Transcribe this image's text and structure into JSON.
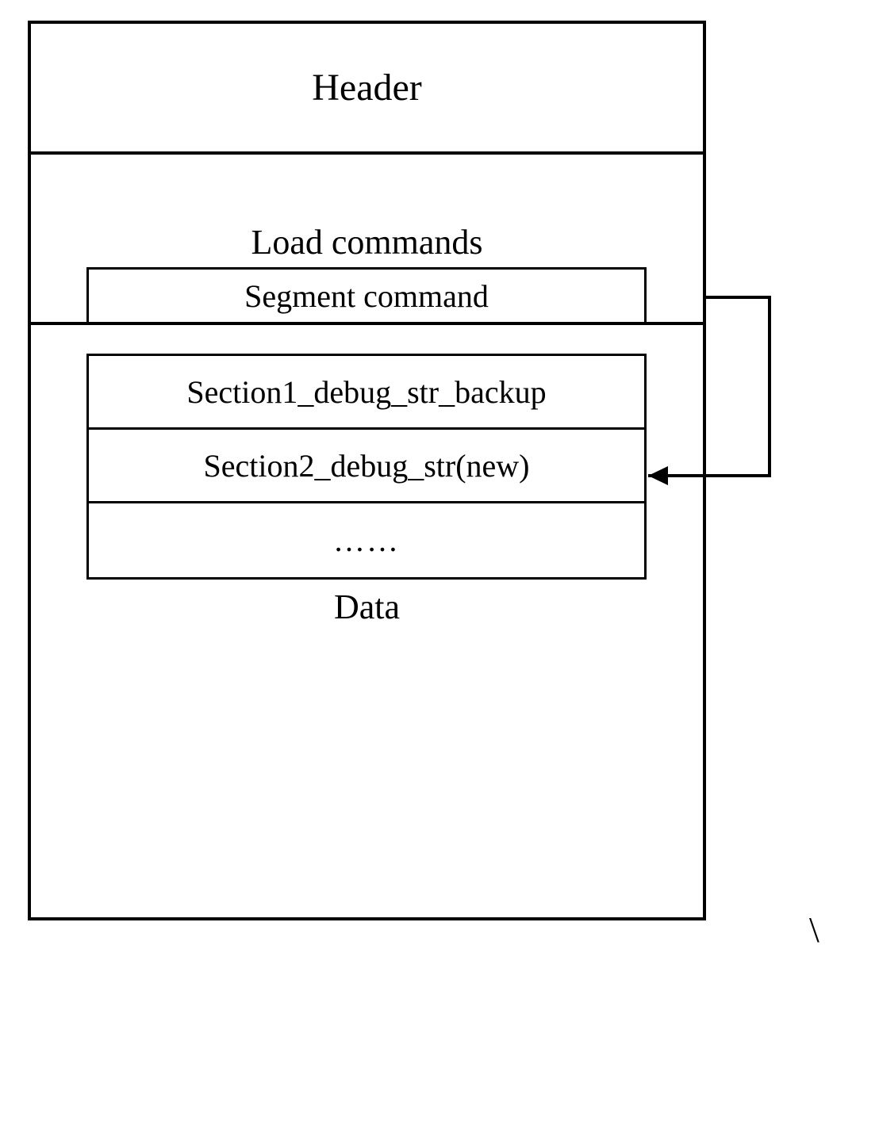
{
  "diagram": {
    "header": "Header",
    "load_commands_label": "Load commands",
    "segment_label": "Segment command",
    "sections": {
      "s1": "Section1_debug_str_backup",
      "s2": "Section2_debug_str(new)",
      "s3": "……"
    },
    "data_label": "Data"
  },
  "extras": {
    "backslash": "\\"
  }
}
